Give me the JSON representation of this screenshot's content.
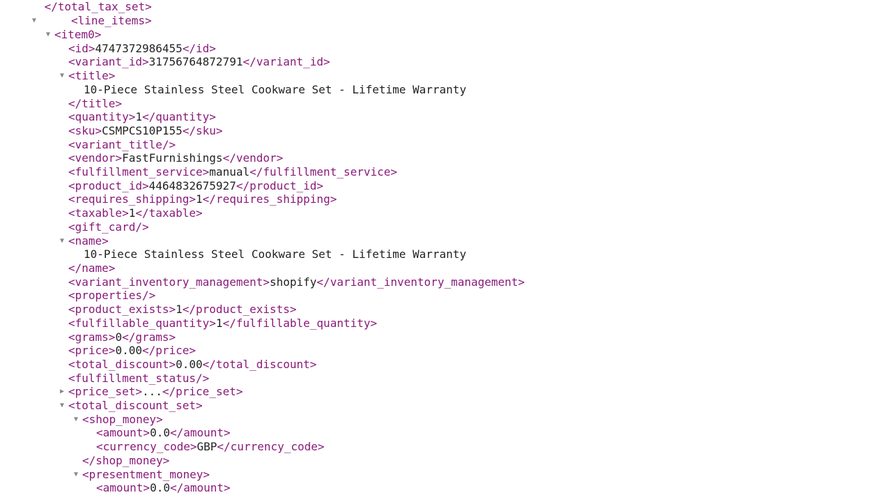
{
  "lines": {
    "l0_close_total_tax_set": "</total_tax_set>",
    "l1_open_line_items": "<line_items>",
    "l2_open_item0": "<item0>",
    "l3_id_tag_o": "<id>",
    "l3_id_val": "4747372986455",
    "l3_id_tag_c": "</id>",
    "l4_vid_tag_o": "<variant_id>",
    "l4_vid_val": "31756764872791",
    "l4_vid_tag_c": "</variant_id>",
    "l5_title_o": "<title>",
    "l6_title_txt": "10-Piece Stainless Steel Cookware Set - Lifetime Warranty",
    "l7_title_c": "</title>",
    "l8_q_o": "<quantity>",
    "l8_q_v": "1",
    "l8_q_c": "</quantity>",
    "l9_sku_o": "<sku>",
    "l9_sku_v": "CSMPCS10P155",
    "l9_sku_c": "</sku>",
    "l10_vt": "<variant_title/>",
    "l11_v_o": "<vendor>",
    "l11_v_v": "FastFurnishings",
    "l11_v_c": "</vendor>",
    "l12_fs_o": "<fulfillment_service>",
    "l12_fs_v": "manual",
    "l12_fs_c": "</fulfillment_service>",
    "l13_pid_o": "<product_id>",
    "l13_pid_v": "4464832675927",
    "l13_pid_c": "</product_id>",
    "l14_rs_o": "<requires_shipping>",
    "l14_rs_v": "1",
    "l14_rs_c": "</requires_shipping>",
    "l15_tx_o": "<taxable>",
    "l15_tx_v": "1",
    "l15_tx_c": "</taxable>",
    "l16_gc": "<gift_card/>",
    "l17_name_o": "<name>",
    "l18_name_txt": "10-Piece Stainless Steel Cookware Set - Lifetime Warranty",
    "l19_name_c": "</name>",
    "l20_vim_o": "<variant_inventory_management>",
    "l20_vim_v": "shopify",
    "l20_vim_c": "</variant_inventory_management>",
    "l21_props": "<properties/>",
    "l22_pe_o": "<product_exists>",
    "l22_pe_v": "1",
    "l22_pe_c": "</product_exists>",
    "l23_fq_o": "<fulfillable_quantity>",
    "l23_fq_v": "1",
    "l23_fq_c": "</fulfillable_quantity>",
    "l24_g_o": "<grams>",
    "l24_g_v": "0",
    "l24_g_c": "</grams>",
    "l25_p_o": "<price>",
    "l25_p_v": "0.00",
    "l25_p_c": "</price>",
    "l26_td_o": "<total_discount>",
    "l26_td_v": "0.00",
    "l26_td_c": "</total_discount>",
    "l27_fstat": "<fulfillment_status/>",
    "l28_ps_o": "<price_set>",
    "l28_ps_mid": "...",
    "l28_ps_c": "</price_set>",
    "l29_tds_o": "<total_discount_set>",
    "l30_sm_o": "<shop_money>",
    "l31_am_o": "<amount>",
    "l31_am_v": "0.0",
    "l31_am_c": "</amount>",
    "l32_cc_o": "<currency_code>",
    "l32_cc_v": "GBP",
    "l32_cc_c": "</currency_code>",
    "l33_sm_c": "</shop_money>",
    "l34_pm_o": "<presentment_money>",
    "l35_am_o": "<amount>",
    "l35_am_v": "0.0",
    "l35_am_c": "</amount>"
  },
  "tri_down": "▼",
  "tri_right": "▶"
}
